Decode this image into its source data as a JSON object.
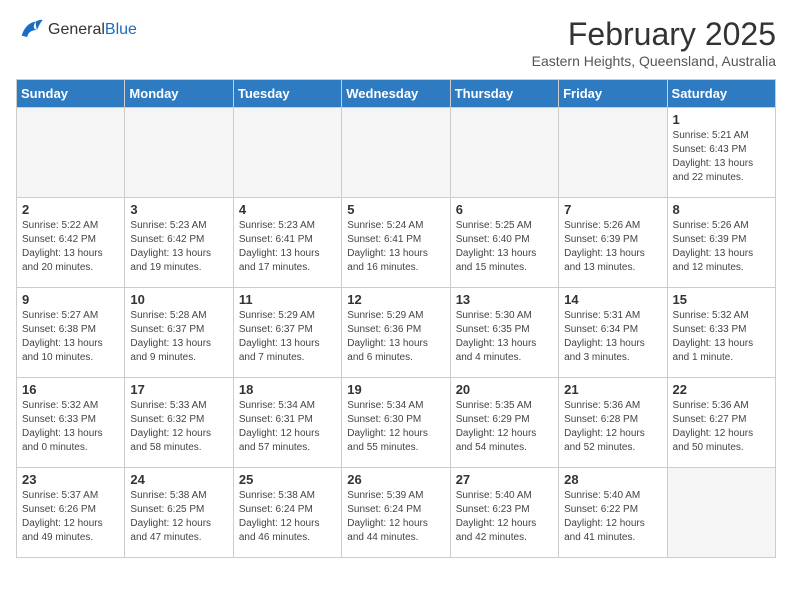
{
  "header": {
    "logo_general": "General",
    "logo_blue": "Blue",
    "month_title": "February 2025",
    "location": "Eastern Heights, Queensland, Australia"
  },
  "days_of_week": [
    "Sunday",
    "Monday",
    "Tuesday",
    "Wednesday",
    "Thursday",
    "Friday",
    "Saturday"
  ],
  "weeks": [
    [
      {
        "day": "",
        "info": ""
      },
      {
        "day": "",
        "info": ""
      },
      {
        "day": "",
        "info": ""
      },
      {
        "day": "",
        "info": ""
      },
      {
        "day": "",
        "info": ""
      },
      {
        "day": "",
        "info": ""
      },
      {
        "day": "1",
        "info": "Sunrise: 5:21 AM\nSunset: 6:43 PM\nDaylight: 13 hours\nand 22 minutes."
      }
    ],
    [
      {
        "day": "2",
        "info": "Sunrise: 5:22 AM\nSunset: 6:42 PM\nDaylight: 13 hours\nand 20 minutes."
      },
      {
        "day": "3",
        "info": "Sunrise: 5:23 AM\nSunset: 6:42 PM\nDaylight: 13 hours\nand 19 minutes."
      },
      {
        "day": "4",
        "info": "Sunrise: 5:23 AM\nSunset: 6:41 PM\nDaylight: 13 hours\nand 17 minutes."
      },
      {
        "day": "5",
        "info": "Sunrise: 5:24 AM\nSunset: 6:41 PM\nDaylight: 13 hours\nand 16 minutes."
      },
      {
        "day": "6",
        "info": "Sunrise: 5:25 AM\nSunset: 6:40 PM\nDaylight: 13 hours\nand 15 minutes."
      },
      {
        "day": "7",
        "info": "Sunrise: 5:26 AM\nSunset: 6:39 PM\nDaylight: 13 hours\nand 13 minutes."
      },
      {
        "day": "8",
        "info": "Sunrise: 5:26 AM\nSunset: 6:39 PM\nDaylight: 13 hours\nand 12 minutes."
      }
    ],
    [
      {
        "day": "9",
        "info": "Sunrise: 5:27 AM\nSunset: 6:38 PM\nDaylight: 13 hours\nand 10 minutes."
      },
      {
        "day": "10",
        "info": "Sunrise: 5:28 AM\nSunset: 6:37 PM\nDaylight: 13 hours\nand 9 minutes."
      },
      {
        "day": "11",
        "info": "Sunrise: 5:29 AM\nSunset: 6:37 PM\nDaylight: 13 hours\nand 7 minutes."
      },
      {
        "day": "12",
        "info": "Sunrise: 5:29 AM\nSunset: 6:36 PM\nDaylight: 13 hours\nand 6 minutes."
      },
      {
        "day": "13",
        "info": "Sunrise: 5:30 AM\nSunset: 6:35 PM\nDaylight: 13 hours\nand 4 minutes."
      },
      {
        "day": "14",
        "info": "Sunrise: 5:31 AM\nSunset: 6:34 PM\nDaylight: 13 hours\nand 3 minutes."
      },
      {
        "day": "15",
        "info": "Sunrise: 5:32 AM\nSunset: 6:33 PM\nDaylight: 13 hours\nand 1 minute."
      }
    ],
    [
      {
        "day": "16",
        "info": "Sunrise: 5:32 AM\nSunset: 6:33 PM\nDaylight: 13 hours\nand 0 minutes."
      },
      {
        "day": "17",
        "info": "Sunrise: 5:33 AM\nSunset: 6:32 PM\nDaylight: 12 hours\nand 58 minutes."
      },
      {
        "day": "18",
        "info": "Sunrise: 5:34 AM\nSunset: 6:31 PM\nDaylight: 12 hours\nand 57 minutes."
      },
      {
        "day": "19",
        "info": "Sunrise: 5:34 AM\nSunset: 6:30 PM\nDaylight: 12 hours\nand 55 minutes."
      },
      {
        "day": "20",
        "info": "Sunrise: 5:35 AM\nSunset: 6:29 PM\nDaylight: 12 hours\nand 54 minutes."
      },
      {
        "day": "21",
        "info": "Sunrise: 5:36 AM\nSunset: 6:28 PM\nDaylight: 12 hours\nand 52 minutes."
      },
      {
        "day": "22",
        "info": "Sunrise: 5:36 AM\nSunset: 6:27 PM\nDaylight: 12 hours\nand 50 minutes."
      }
    ],
    [
      {
        "day": "23",
        "info": "Sunrise: 5:37 AM\nSunset: 6:26 PM\nDaylight: 12 hours\nand 49 minutes."
      },
      {
        "day": "24",
        "info": "Sunrise: 5:38 AM\nSunset: 6:25 PM\nDaylight: 12 hours\nand 47 minutes."
      },
      {
        "day": "25",
        "info": "Sunrise: 5:38 AM\nSunset: 6:24 PM\nDaylight: 12 hours\nand 46 minutes."
      },
      {
        "day": "26",
        "info": "Sunrise: 5:39 AM\nSunset: 6:24 PM\nDaylight: 12 hours\nand 44 minutes."
      },
      {
        "day": "27",
        "info": "Sunrise: 5:40 AM\nSunset: 6:23 PM\nDaylight: 12 hours\nand 42 minutes."
      },
      {
        "day": "28",
        "info": "Sunrise: 5:40 AM\nSunset: 6:22 PM\nDaylight: 12 hours\nand 41 minutes."
      },
      {
        "day": "",
        "info": ""
      }
    ]
  ]
}
